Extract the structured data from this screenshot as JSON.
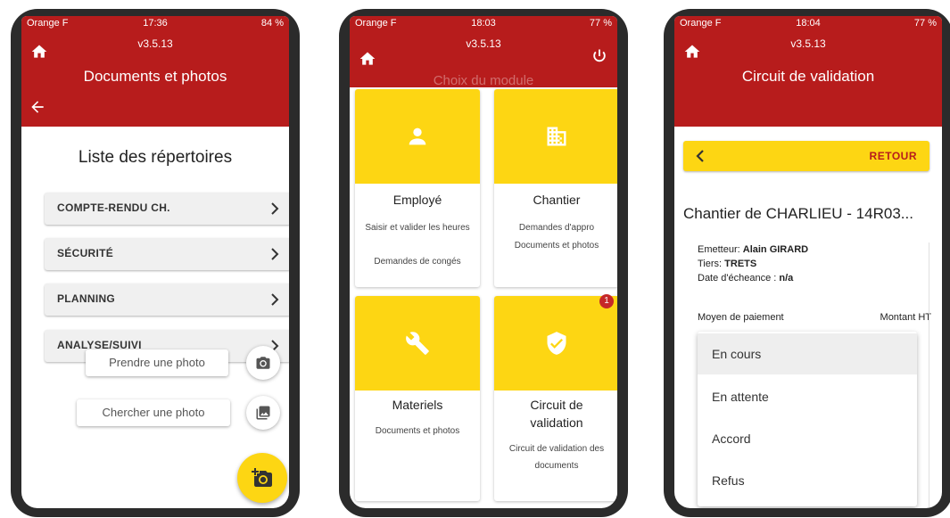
{
  "phone1": {
    "status": {
      "carrier": "Orange F",
      "time": "17:36",
      "battery": "84 %"
    },
    "version": "v3.5.13",
    "title": "Documents et photos",
    "list_title": "Liste des répertoires",
    "directories": [
      {
        "label": "COMPTE-RENDU CH."
      },
      {
        "label": "SÉCURITÉ"
      },
      {
        "label": "PLANNING"
      },
      {
        "label": "ANALYSE/SUIVI"
      }
    ],
    "take_photo_label": "Prendre une photo",
    "search_photo_label": "Chercher une photo",
    "icons": [
      "home-icon",
      "arrow-left-icon",
      "chevron-right-icon",
      "camera-icon",
      "photo-library-icon",
      "add-a-photo-icon"
    ]
  },
  "phone2": {
    "status": {
      "carrier": "Orange F",
      "time": "18:03",
      "battery": "77 %"
    },
    "version": "v3.5.13",
    "module_title": "Choix du module",
    "cards": [
      {
        "title": "Employé",
        "desc": [
          "Saisir et valider les heures",
          "Demandes de congés"
        ],
        "icon": "person-icon"
      },
      {
        "title": "Chantier",
        "desc": [
          "Demandes d'appro",
          "Documents et photos"
        ],
        "icon": "building-icon"
      },
      {
        "title": "Materiels",
        "desc": [
          "Documents et photos"
        ],
        "icon": "wrench-icon"
      },
      {
        "title": "Circuit de validation",
        "desc": [
          "Circuit de validation des documents"
        ],
        "icon": "verified-shield-icon",
        "badge": "1"
      }
    ]
  },
  "phone3": {
    "status": {
      "carrier": "Orange F",
      "time": "18:04",
      "battery": "77 %"
    },
    "version": "v3.5.13",
    "title": "Circuit de validation",
    "retour_label": "RETOUR",
    "chantier_title": "Chantier de CHARLIEU - 14R03...",
    "emetteur_label": "Emetteur:",
    "emetteur_value": "Alain GIRARD",
    "tiers_label": "Tiers:",
    "tiers_value": "TRETS",
    "echeance_label": "Date d'écheance :",
    "echeance_value": "n/a",
    "moyen_label": "Moyen de paiement",
    "montant_label": "Montant HT",
    "status_options": [
      "En cours",
      "En attente",
      "Accord",
      "Refus"
    ],
    "selected_option": "En cours"
  },
  "colors": {
    "primary": "#b71c1c",
    "accent": "#fdd613",
    "badge": "#c62828"
  }
}
